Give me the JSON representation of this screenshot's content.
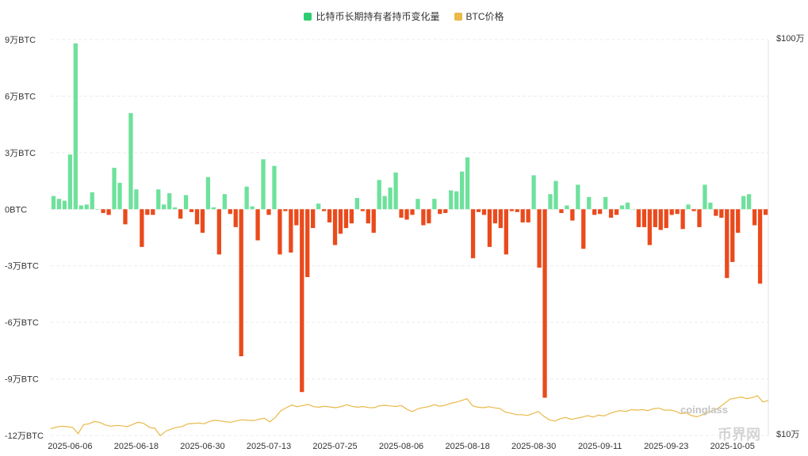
{
  "legend": {
    "bar_label": "比特币长期持有者持币变化量",
    "line_label": "BTC价格"
  },
  "colors": {
    "positive": "#6ee19c",
    "negative": "#ea4a1c",
    "legend_bar": "#2ecc71",
    "price_line": "#e9b949",
    "grid": "#ececec"
  },
  "watermark": {
    "coinglass": "coinglass",
    "site": "币界网"
  },
  "chart_data": {
    "type": "bar",
    "x_tick_labels": [
      "2025-06-06",
      "2025-06-18",
      "2025-06-30",
      "2025-07-13",
      "2025-07-25",
      "2025-08-06",
      "2025-08-18",
      "2025-08-30",
      "2025-09-11",
      "2025-09-23",
      "2025-10-05"
    ],
    "left_axis": {
      "unit": "BTC",
      "ylim": [
        -120000,
        90000
      ],
      "tick_values": [
        90000,
        60000,
        30000,
        0,
        -30000,
        -60000,
        -90000,
        -120000
      ],
      "tick_labels": [
        "9万BTC",
        "6万BTC",
        "3万BTC",
        "0BTC",
        "-3万BTC",
        "-6万BTC",
        "-9万BTC",
        "-12万BTC"
      ]
    },
    "right_axis": {
      "scale": "log",
      "ylim": [
        100000,
        1000000
      ],
      "tick_labels": [
        "$100万",
        "$10万"
      ]
    },
    "grid": true,
    "legend_position": "top-center",
    "series": [
      {
        "name": "比特币长期持有者持币变化量",
        "kind": "bar",
        "values": [
          7000,
          5500,
          4500,
          29000,
          88000,
          2000,
          2500,
          9000,
          0,
          -2000,
          -3000,
          22000,
          14000,
          -8000,
          51000,
          10500,
          -20000,
          -3000,
          -3000,
          10500,
          2500,
          8500,
          1000,
          -5000,
          7500,
          -1500,
          -8000,
          -12500,
          17000,
          1000,
          -24000,
          8000,
          -2500,
          -9500,
          -78000,
          12000,
          1500,
          -16500,
          26500,
          -3000,
          23000,
          -24000,
          -1000,
          -23000,
          -8500,
          -97000,
          -36000,
          -10000,
          3000,
          -1000,
          -7000,
          -19000,
          -13000,
          -10000,
          -7500,
          6000,
          -1000,
          -7500,
          -12500,
          15500,
          7000,
          11500,
          19500,
          -4500,
          -5500,
          -3000,
          5500,
          -8500,
          -7500,
          5500,
          -2500,
          -2000,
          10000,
          9500,
          20000,
          27500,
          -26000,
          -1500,
          -3000,
          -20000,
          -7500,
          -10000,
          -24000,
          -1000,
          -1500,
          -7000,
          -7000,
          18000,
          -31000,
          -100000,
          8000,
          15000,
          -2000,
          2000,
          -6000,
          13000,
          -21000,
          6500,
          -3000,
          -2500,
          6500,
          -4500,
          -3000,
          2000,
          3500,
          0,
          -9500,
          -9500,
          -19000,
          -9500,
          -11000,
          -10000,
          -3000,
          -2500,
          -10500,
          2500,
          -1000,
          -9500,
          13000,
          3500,
          -3500,
          -4500,
          -36500,
          -28000,
          -12500,
          7000,
          8000,
          -8500,
          -39500,
          -3000
        ]
      },
      {
        "kind": "line",
        "price_usd": [
          104000,
          105000,
          105500,
          105200,
          104800,
          101000,
          106500,
          107000,
          108500,
          107800,
          106200,
          105500,
          106000,
          105800,
          105200,
          106700,
          108000,
          107200,
          104800,
          104200,
          99800,
          102500,
          103800,
          104800,
          105300,
          106900,
          107200,
          107500,
          107000,
          108500,
          109200,
          108800,
          108200,
          108000,
          109000,
          109500,
          109200,
          109000,
          109800,
          110500,
          108200,
          111000,
          115500,
          117500,
          119300,
          118200,
          119000,
          119800,
          118200,
          117800,
          118500,
          118000,
          117500,
          118200,
          119500,
          118400,
          117800,
          118300,
          117600,
          117500,
          118800,
          119200,
          118700,
          118300,
          119000,
          116500,
          114800,
          116800,
          117600,
          118200,
          119500,
          118500,
          119200,
          120500,
          121300,
          122500,
          123800,
          118800,
          117800,
          117500,
          118200,
          117400,
          117000,
          114500,
          113800,
          112800,
          112800,
          112300,
          113500,
          115000,
          111800,
          109500,
          108700,
          110200,
          111000,
          109800,
          110500,
          111200,
          112200,
          111300,
          112500,
          112000,
          113500,
          114800,
          115500,
          115000,
          116200,
          115800,
          116200,
          115500,
          116800,
          117200,
          115800,
          116000,
          115200,
          113500,
          114000,
          112200,
          111500,
          112800,
          114300,
          115800,
          117500,
          120500,
          123500,
          124200,
          125100,
          123800,
          124500,
          126000,
          121500,
          122500
        ]
      }
    ]
  }
}
